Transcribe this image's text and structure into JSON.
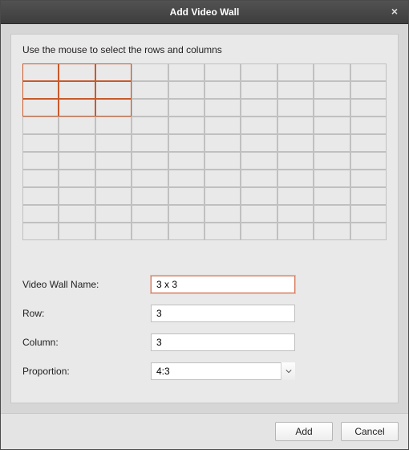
{
  "dialog": {
    "title": "Add Video Wall",
    "close_label": "×"
  },
  "instruction": "Use the mouse to select the rows and columns",
  "grid": {
    "total_rows": 10,
    "total_cols": 10,
    "selected_rows": 3,
    "selected_cols": 3
  },
  "form": {
    "name_label": "Video Wall Name:",
    "name_value": "3 x 3",
    "row_label": "Row:",
    "row_value": "3",
    "column_label": "Column:",
    "column_value": "3",
    "proportion_label": "Proportion:",
    "proportion_value": "4:3"
  },
  "buttons": {
    "add": "Add",
    "cancel": "Cancel"
  }
}
